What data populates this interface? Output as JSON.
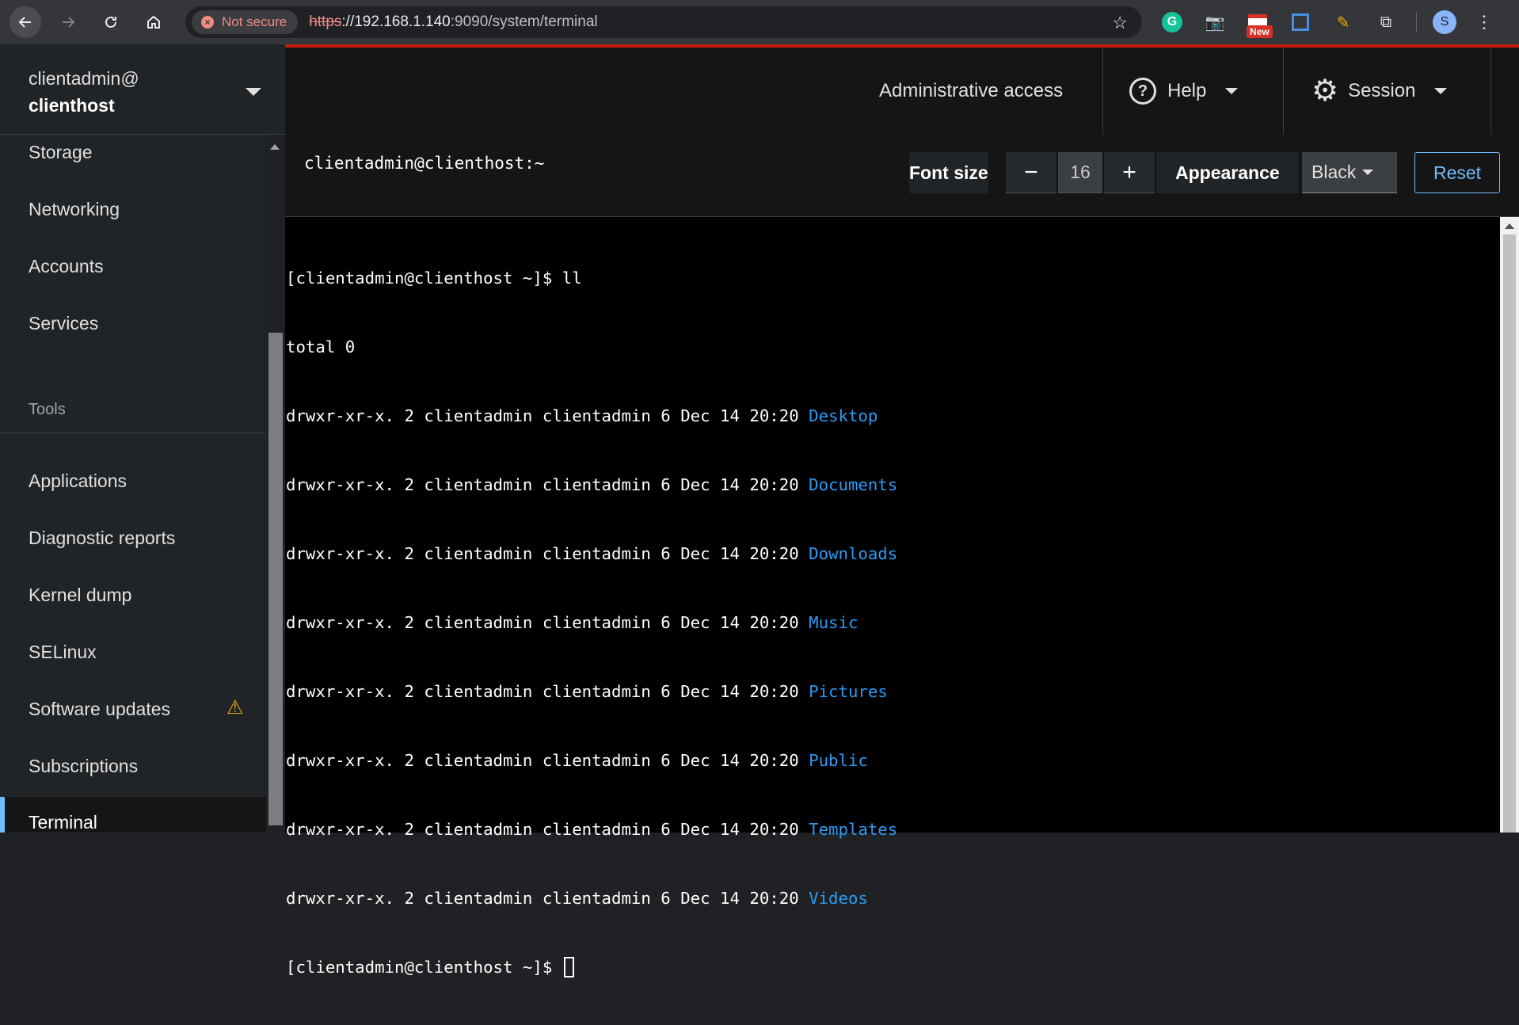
{
  "browser": {
    "security_label": "Not secure",
    "url_scheme": "https",
    "url_host": "://192.168.1.140",
    "url_rest": ":9090/system/terminal",
    "new_badge": "New",
    "profile_initial": "S"
  },
  "host_switcher": {
    "user": "clientadmin@",
    "host": "clienthost"
  },
  "topbar": {
    "admin_access": "Administrative access",
    "help": "Help",
    "session": "Session"
  },
  "sidebar": {
    "items_top": [
      "Storage",
      "Networking",
      "Accounts",
      "Services"
    ],
    "tools_section": "Tools",
    "tools_items": [
      "Applications",
      "Diagnostic reports",
      "Kernel dump",
      "SELinux",
      "Software updates",
      "Subscriptions",
      "Terminal"
    ],
    "active_item": "Terminal",
    "warning_item": "Software updates"
  },
  "terminal_header": {
    "title": "clientadmin@clienthost:~",
    "font_size_label": "Font size",
    "font_size_value": "16",
    "minus": "−",
    "plus": "+",
    "appearance_label": "Appearance",
    "appearance_value": "Black",
    "reset": "Reset"
  },
  "terminal": {
    "command_line": "[clientadmin@clienthost ~]$ ll",
    "total_line": "total 0",
    "entry_prefix": "drwxr-xr-x. 2 clientadmin clientadmin 6 Dec 14 20:20 ",
    "dirs": [
      "Desktop",
      "Documents",
      "Downloads",
      "Music",
      "Pictures",
      "Public",
      "Templates",
      "Videos"
    ],
    "prompt": "[clientadmin@clienthost ~]$ "
  },
  "colors": {
    "accent_blue": "#73bcf7",
    "dir_blue": "#2b9af3",
    "warning": "#f0ab00",
    "danger_red": "#c9190b"
  }
}
